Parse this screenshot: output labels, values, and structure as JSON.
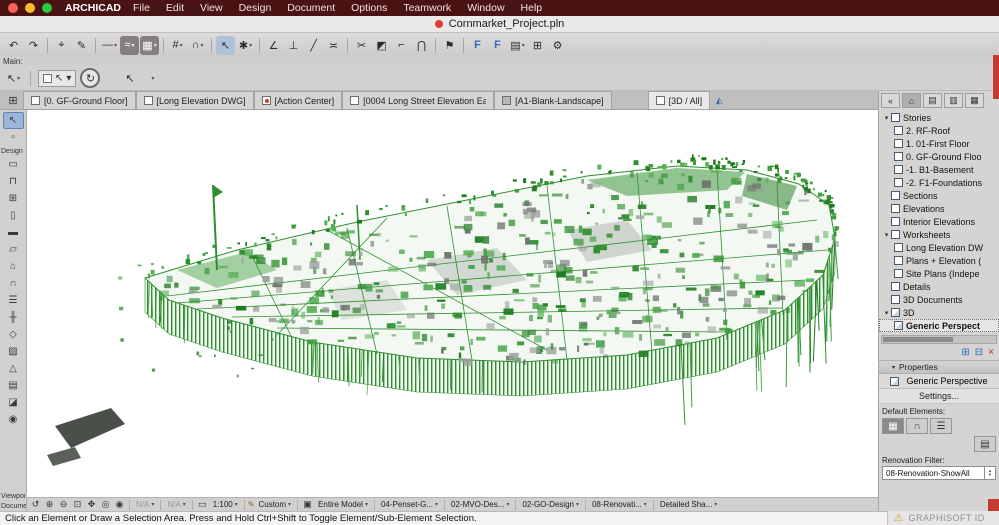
{
  "glyphs": {
    "undo": "↶",
    "redo": "↷",
    "pickup": "⌖",
    "inject": "✎",
    "line": "—",
    "polyline": "≈",
    "fill": "▦",
    "grid": "#",
    "magnet": "∩",
    "cursor": "↖",
    "wand": "✱",
    "angle": "∠",
    "perp": "⊥",
    "slash": "╱",
    "offset": "≍",
    "scissors": "✂",
    "split": "◩",
    "adjust": "⌐",
    "intersect": "⋂",
    "flag": "⚑",
    "favorite": "F",
    "sheet": "▤",
    "table": "⊞",
    "gear": "⚙",
    "dropdown": "▾",
    "tree_open": "▾",
    "chevron": "▸",
    "back": "«",
    "quad": "⊞",
    "rotate": "↻",
    "prev": "↺",
    "zoom_in": "⊕",
    "zoom_out": "⊖",
    "fit": "⊡",
    "pan": "✥",
    "orbit": "◎",
    "explore": "◉",
    "close": "×",
    "warning": "⚠",
    "new_folder": "⊞",
    "clone": "⊟",
    "pin": "⊙",
    "home": "⌂",
    "view_map": "▤",
    "layout_book": "▥",
    "publisher": "▦",
    "spin_up": "▲",
    "spin_down": "▼",
    "slider": "▭",
    "pen": "✎",
    "eye": "◎",
    "layers": "▤",
    "book": "▣",
    "camera": "◭",
    "arrow": "↖",
    "marquee": "▫",
    "wall": "▭",
    "door": "⊓",
    "window": "⊞",
    "column": "▯",
    "beam": "▬",
    "slab": "▱",
    "roof": "⌂",
    "shell": "∩",
    "stair": "☰",
    "railing": "╫",
    "morph": "◇",
    "zone": "▨",
    "mesh": "△",
    "curtain": "▤",
    "object": "◪",
    "lamp": "◉"
  },
  "menu_bar": {
    "app_name": "ARCHICAD",
    "items": [
      "File",
      "Edit",
      "View",
      "Design",
      "Document",
      "Options",
      "Teamwork",
      "Window",
      "Help"
    ]
  },
  "title_bar": {
    "document_title": "Cornmarket_Project.pln"
  },
  "main_label": "Main:",
  "tab_bar": {
    "tabs": [
      {
        "label": "[0. GF-Ground Floor]"
      },
      {
        "label": "[Long Elevation DWG]"
      },
      {
        "label": "[Action Center]"
      },
      {
        "label": "[0004 Long Street Elevation Ea..."
      },
      {
        "label": "[A1-Blank-Landscape]"
      },
      {
        "label": "[3D / All]"
      }
    ]
  },
  "toolbox": {
    "design_label": "Design",
    "viewpoint_label": "Viewpoi...",
    "document_label": "Docume..."
  },
  "navigator": {
    "tree": [
      {
        "label": "Stories"
      },
      {
        "label": "2. RF-Roof"
      },
      {
        "label": "1. 01-First Floor"
      },
      {
        "label": "0. GF-Ground Floo"
      },
      {
        "label": "-1. B1-Basement"
      },
      {
        "label": "-2. F1-Foundations"
      },
      {
        "label": "Sections"
      },
      {
        "label": "Elevations"
      },
      {
        "label": "Interior Elevations"
      },
      {
        "label": "Worksheets"
      },
      {
        "label": "Long Elevation DW"
      },
      {
        "label": "Plans + Elevation ("
      },
      {
        "label": "Site Plans (Indepe"
      },
      {
        "label": "Details"
      },
      {
        "label": "3D Documents"
      },
      {
        "label": "3D"
      },
      {
        "label": "Generic Perspect"
      }
    ],
    "properties_label": "Properties",
    "current_view": "Generic Perspective",
    "settings_label": "Settings...",
    "default_elements_label": "Default Elements:",
    "renovation_filter_label": "Renovation Filter:",
    "renovation_filter_value": "08-Renovation-ShowAll"
  },
  "bottom_bar": {
    "na_1": "N/A",
    "na_2": "N/A",
    "scale": "1:100",
    "zoom_preset": "Custom",
    "model_filter": "Entire Model",
    "pen_set": "04-Penset-G...",
    "mvo": "02-MVO-Des...",
    "graphic_override": "02-GO-Design",
    "renovation": "08-Renovati...",
    "style": "Detailed Sha..."
  },
  "status_bar": {
    "message": "Click an Element or Draw a Selection Area. Press and Hold Ctrl+Shift to Toggle Element/Sub-Element Selection.",
    "brand": "GRAPHISOFT ID"
  }
}
